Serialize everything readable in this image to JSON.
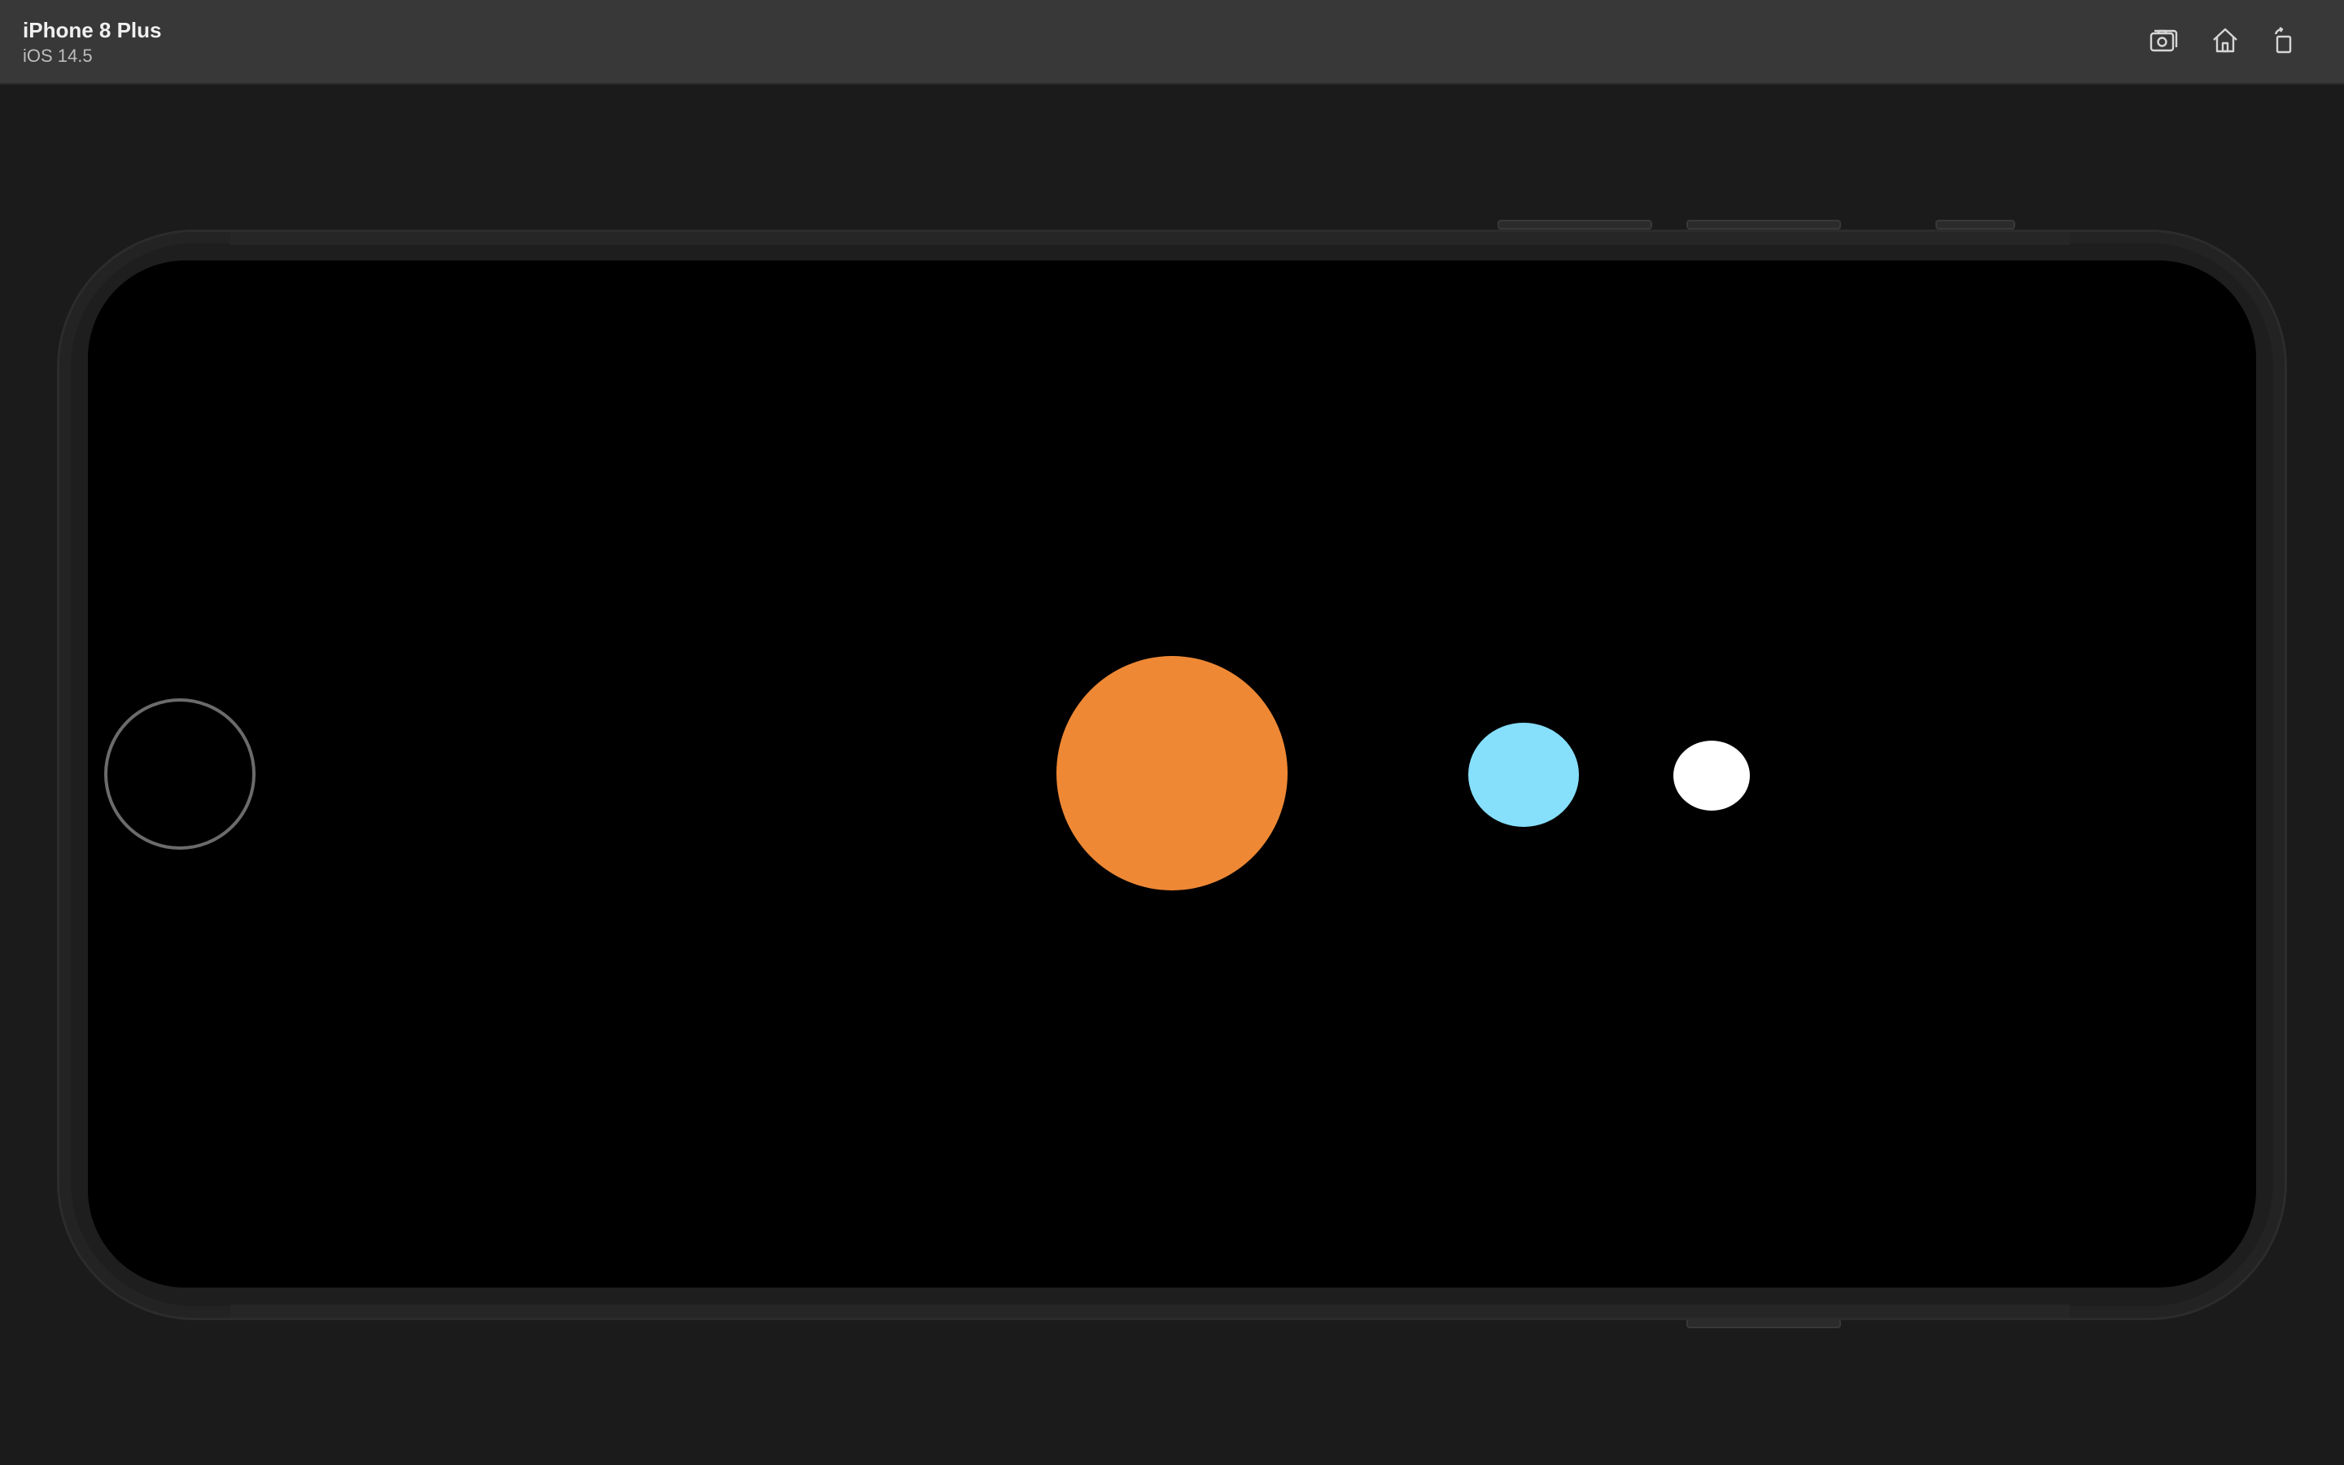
{
  "titlebar": {
    "device_name": "iPhone 8 Plus",
    "os_version": "iOS 14.5",
    "buttons": [
      {
        "name": "screenshot-icon"
      },
      {
        "name": "home-icon"
      },
      {
        "name": "rotate-icon"
      }
    ]
  },
  "scene": {
    "background": "#000000",
    "bodies": [
      {
        "name": "orange-circle",
        "color": "#ee8835"
      },
      {
        "name": "light-blue-circle",
        "color": "#86dffb"
      },
      {
        "name": "white-circle",
        "color": "#ffffff"
      }
    ]
  },
  "colors": {
    "chrome_background": "#1b1b1b",
    "titlebar": "#383838",
    "phone_frame": "#1e1e1e"
  }
}
